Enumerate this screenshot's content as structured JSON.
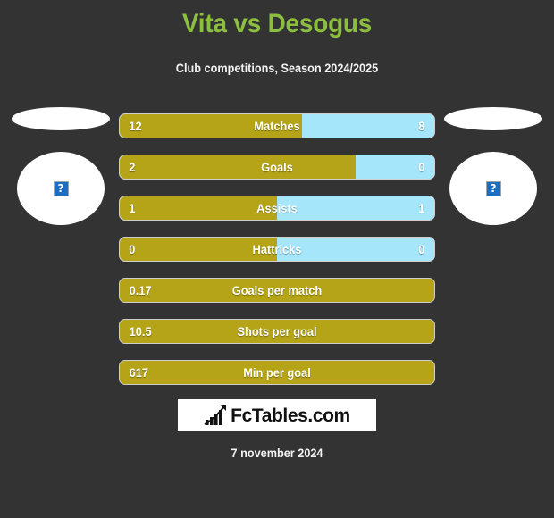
{
  "header": {
    "title": "Vita vs Desogus",
    "subtitle": "Club competitions, Season 2024/2025",
    "title_color": "#8cbf3f",
    "subtitle_color": "#f2f2f2"
  },
  "colors": {
    "background": "#333333",
    "home_bar": "#b5a417",
    "away_bar": "#a5e6fa",
    "bar_outline": "#cfcfcf",
    "value_text": "#ffffff",
    "placeholder_blue": "#1b6ec2"
  },
  "players": {
    "left": {
      "name_placeholder": "",
      "photo_icon": "broken-image-icon",
      "photo_glyph": "?"
    },
    "right": {
      "name_placeholder": "",
      "photo_icon": "broken-image-icon",
      "photo_glyph": "?"
    }
  },
  "chart_data": {
    "type": "bar",
    "title": "Vita vs Desogus",
    "subtitle": "Club competitions, Season 2024/2025",
    "orientation": "horizontal-diverging",
    "series": [
      {
        "name": "Vita",
        "side": "left",
        "color": "#b5a417"
      },
      {
        "name": "Desogus",
        "side": "right",
        "color": "#a5e6fa"
      }
    ],
    "categories": [
      "Matches",
      "Goals",
      "Assists",
      "Hattricks",
      "Goals per match",
      "Shots per goal",
      "Min per goal"
    ],
    "rows": [
      {
        "label": "Matches",
        "left": "12",
        "right": "8",
        "left_pct": 58,
        "two_sided": true
      },
      {
        "label": "Goals",
        "left": "2",
        "right": "0",
        "left_pct": 75,
        "two_sided": true
      },
      {
        "label": "Assists",
        "left": "1",
        "right": "1",
        "left_pct": 50,
        "two_sided": true
      },
      {
        "label": "Hattricks",
        "left": "0",
        "right": "0",
        "left_pct": 50,
        "two_sided": true
      },
      {
        "label": "Goals per match",
        "left": "0.17",
        "right": "",
        "left_pct": 100,
        "two_sided": false
      },
      {
        "label": "Shots per goal",
        "left": "10.5",
        "right": "",
        "left_pct": 100,
        "two_sided": false
      },
      {
        "label": "Min per goal",
        "left": "617",
        "right": "",
        "left_pct": 100,
        "two_sided": false
      }
    ]
  },
  "logo": {
    "text": "FcTables.com",
    "icon": "bar-chart-growth-icon"
  },
  "footer": {
    "date": "7 november 2024"
  }
}
